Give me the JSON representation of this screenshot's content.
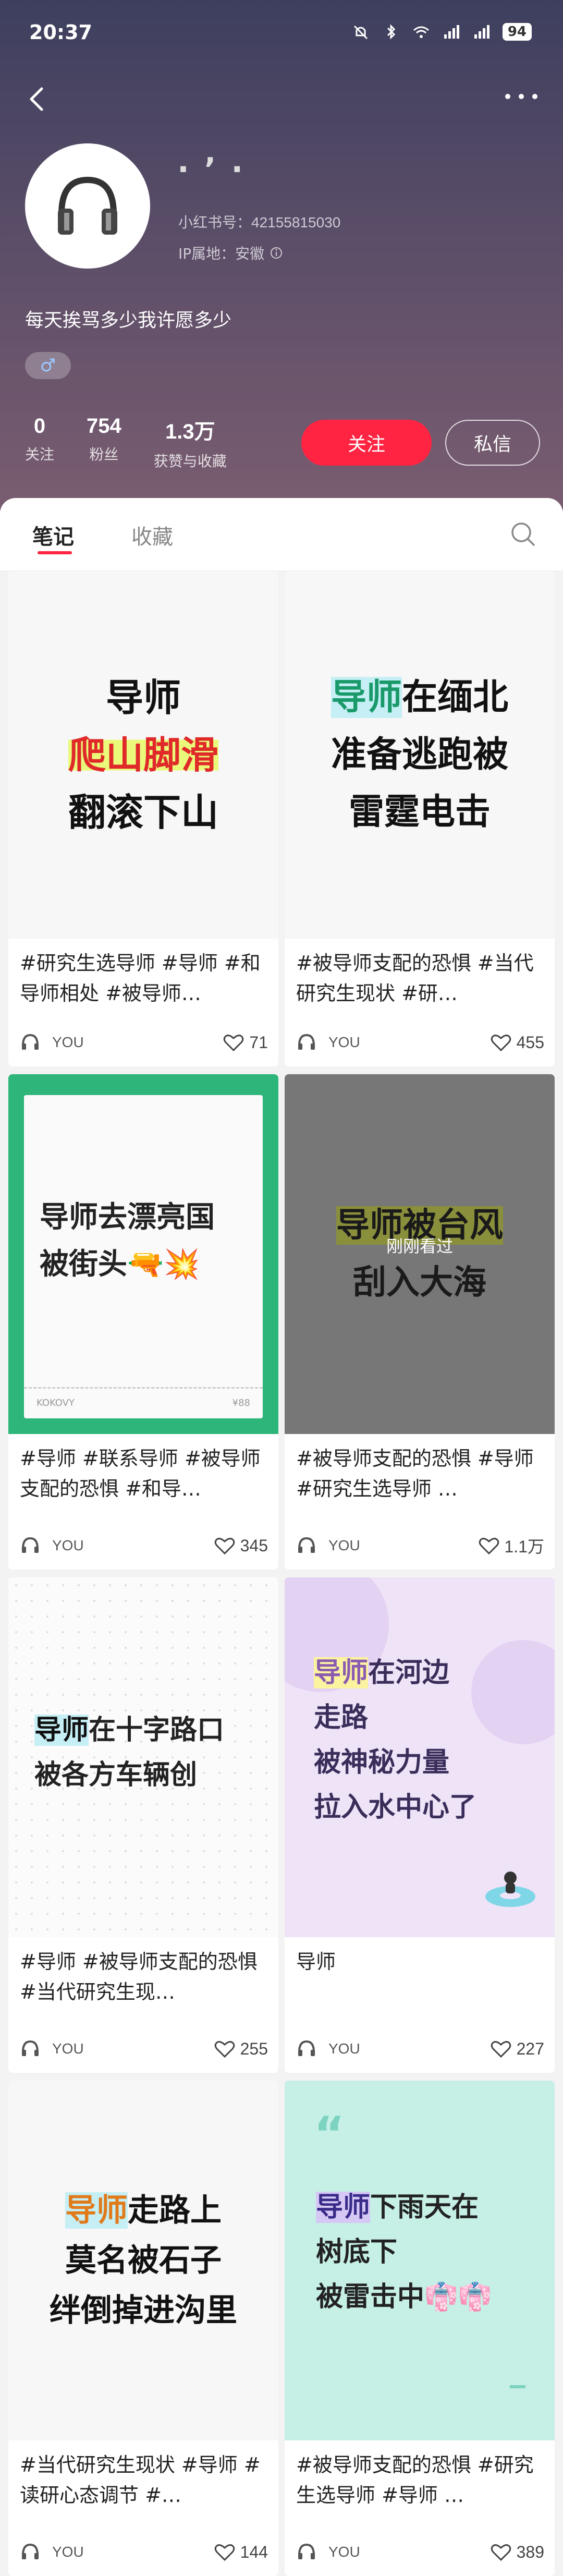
{
  "status": {
    "time": "20:37",
    "battery": "94"
  },
  "profile": {
    "nickname": "· ’ ·",
    "red_id": "小红书号：42155815030",
    "ip": "IP属地：安徽",
    "bio": "每天挨骂多少我许愿多少",
    "gender_symbol": "♂"
  },
  "stats": [
    {
      "num": "0",
      "label": "关注"
    },
    {
      "num": "754",
      "label": "粉丝"
    },
    {
      "num": "1.3万",
      "label": "获赞与收藏"
    }
  ],
  "buttons": {
    "follow": "关注",
    "message": "私信"
  },
  "tabs": {
    "notes": "笔记",
    "collect": "收藏"
  },
  "cards": [
    {
      "cover_lines": [
        "导师",
        "爬山脚滑",
        "翻滚下山"
      ],
      "title": "#研究生选导师 #导师 #和导师相处 #被导师…",
      "author": "YOU",
      "likes": "71"
    },
    {
      "cover_lines": [
        "导师在缅北",
        "准备逃跑被",
        "雷霆电击"
      ],
      "title": "#被导师支配的恐惧 #当代研究生现状 #研…",
      "author": "YOU",
      "likes": "455"
    },
    {
      "cover_lines": [
        "导师去漂亮国",
        "被街头🔫💥"
      ],
      "title": "#导师 #联系导师 #被导师支配的恐惧 #和导…",
      "author": "YOU",
      "likes": "345",
      "ticket_code": "KOKOVY",
      "ticket_price": "¥88"
    },
    {
      "cover_lines": [
        "导师被台风",
        "刮入大海"
      ],
      "seen": "刚刚看过",
      "title": "#被导师支配的恐惧 #导师 #研究生选导师 …",
      "author": "YOU",
      "likes": "1.1万"
    },
    {
      "cover_lines": [
        "导师在十字路口",
        "被各方车辆创"
      ],
      "title": "#导师 #被导师支配的恐惧 #当代研究生现…",
      "author": "YOU",
      "likes": "255"
    },
    {
      "cover_lines": [
        "导师在河边",
        "走路",
        "被神秘力量",
        "拉入水中心了"
      ],
      "title": "导师",
      "author": "YOU",
      "likes": "227"
    },
    {
      "cover_lines": [
        "导师走路上",
        "莫名被石子",
        "绊倒掉进沟里"
      ],
      "title": "#当代研究生现状 #导师 #读研心态调节 #…",
      "author": "YOU",
      "likes": "144"
    },
    {
      "cover_lines": [
        "导师下雨天在",
        "树底下",
        "被雷击中👘👘"
      ],
      "title": "#被导师支配的恐惧 #研究生选导师 #导师 …",
      "author": "YOU",
      "likes": "389"
    }
  ],
  "colors": {
    "accent": "#ff2442",
    "header_top": "#3d3f5e",
    "header_bottom": "#7a5d70"
  }
}
